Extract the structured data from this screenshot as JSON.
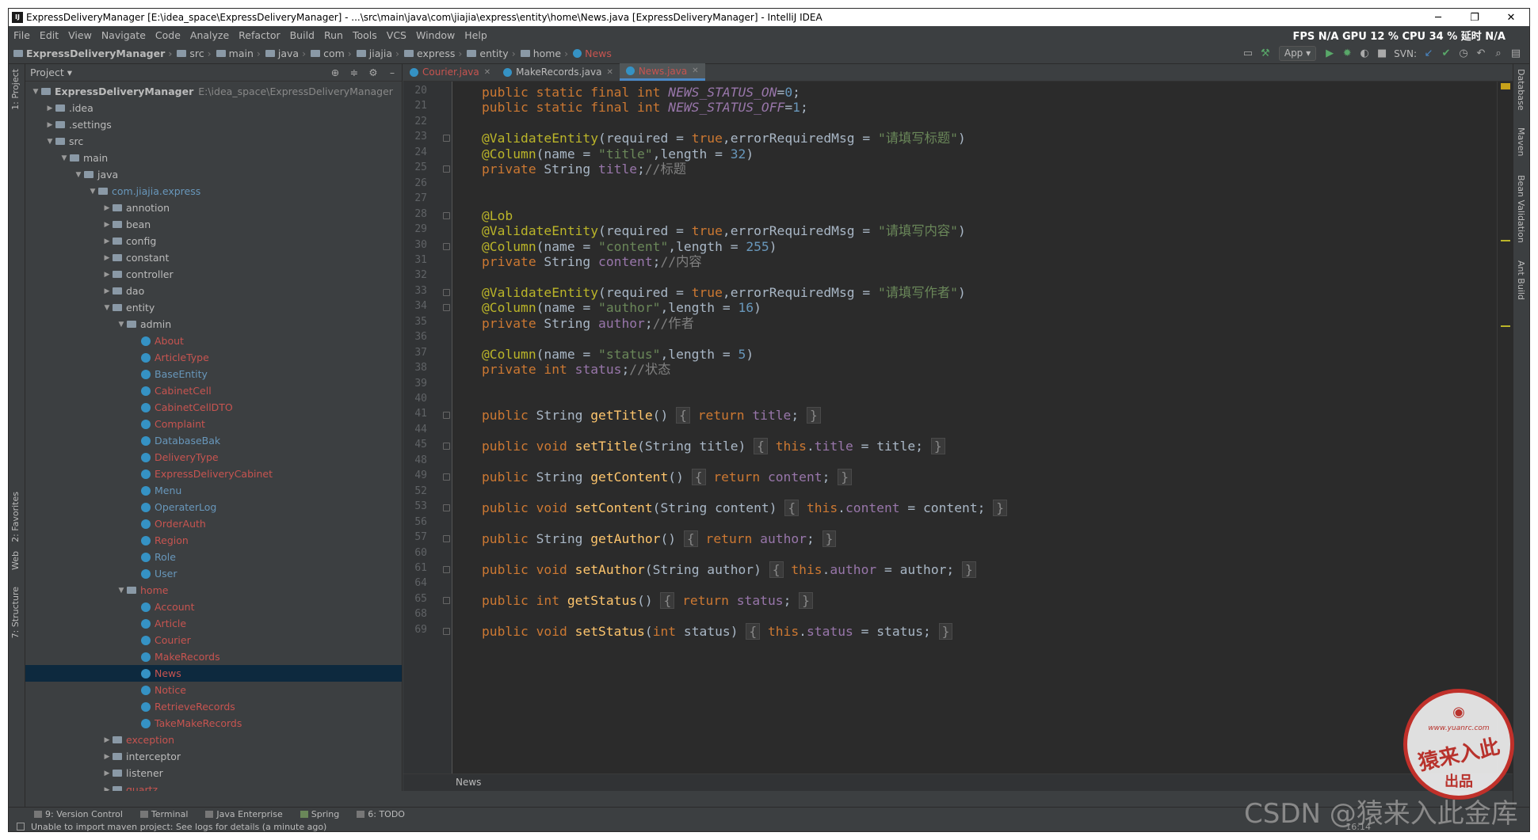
{
  "window": {
    "title": "ExpressDeliveryManager [E:\\idea_space\\ExpressDeliveryManager] - ...\\src\\main\\java\\com\\jiajia\\express\\entity\\home\\News.java [ExpressDeliveryManager] - IntelliJ IDEA",
    "app_icon": "IJ",
    "minimize": "─",
    "maximize": "❐",
    "close": "✕"
  },
  "menu": [
    "File",
    "Edit",
    "View",
    "Navigate",
    "Code",
    "Analyze",
    "Refactor",
    "Build",
    "Run",
    "Tools",
    "VCS",
    "Window",
    "Help"
  ],
  "perf": "FPS  N/A  GPU  12 %  CPU  34 %  延时  N/A",
  "breadcrumbs": [
    "ExpressDeliveryManager",
    "src",
    "main",
    "java",
    "com",
    "jiajia",
    "express",
    "entity",
    "home",
    "News"
  ],
  "toolbar": {
    "run_config": "App ▾",
    "svn_label": "SVN:"
  },
  "project_panel": {
    "title": "Project ▾",
    "root_path": "E:\\idea_space\\ExpressDeliveryManager",
    "tree": [
      {
        "label": "ExpressDeliveryManager",
        "level": 0,
        "arrow": "▼",
        "type": "folder",
        "bold": true
      },
      {
        "label": ".idea",
        "level": 1,
        "arrow": "▶",
        "type": "folder"
      },
      {
        "label": ".settings",
        "level": 1,
        "arrow": "▶",
        "type": "folder"
      },
      {
        "label": "src",
        "level": 1,
        "arrow": "▼",
        "type": "folder"
      },
      {
        "label": "main",
        "level": 2,
        "arrow": "▼",
        "type": "folder"
      },
      {
        "label": "java",
        "level": 3,
        "arrow": "▼",
        "type": "folder"
      },
      {
        "label": "com.jiajia.express",
        "level": 4,
        "arrow": "▼",
        "type": "package",
        "color": "teal"
      },
      {
        "label": "annotion",
        "level": 5,
        "arrow": "▶",
        "type": "package"
      },
      {
        "label": "bean",
        "level": 5,
        "arrow": "▶",
        "type": "package"
      },
      {
        "label": "config",
        "level": 5,
        "arrow": "▶",
        "type": "package"
      },
      {
        "label": "constant",
        "level": 5,
        "arrow": "▶",
        "type": "package"
      },
      {
        "label": "controller",
        "level": 5,
        "arrow": "▶",
        "type": "package"
      },
      {
        "label": "dao",
        "level": 5,
        "arrow": "▶",
        "type": "package"
      },
      {
        "label": "entity",
        "level": 5,
        "arrow": "▼",
        "type": "package"
      },
      {
        "label": "admin",
        "level": 6,
        "arrow": "▼",
        "type": "package"
      },
      {
        "label": "About",
        "level": 7,
        "type": "class",
        "color": "red"
      },
      {
        "label": "ArticleType",
        "level": 7,
        "type": "class",
        "color": "red"
      },
      {
        "label": "BaseEntity",
        "level": 7,
        "type": "class",
        "color": "teal"
      },
      {
        "label": "CabinetCell",
        "level": 7,
        "type": "class",
        "color": "red"
      },
      {
        "label": "CabinetCellDTO",
        "level": 7,
        "type": "class",
        "color": "red"
      },
      {
        "label": "Complaint",
        "level": 7,
        "type": "class",
        "color": "red"
      },
      {
        "label": "DatabaseBak",
        "level": 7,
        "type": "class",
        "color": "teal"
      },
      {
        "label": "DeliveryType",
        "level": 7,
        "type": "class",
        "color": "red"
      },
      {
        "label": "ExpressDeliveryCabinet",
        "level": 7,
        "type": "class",
        "color": "red"
      },
      {
        "label": "Menu",
        "level": 7,
        "type": "class",
        "color": "teal"
      },
      {
        "label": "OperaterLog",
        "level": 7,
        "type": "class",
        "color": "teal"
      },
      {
        "label": "OrderAuth",
        "level": 7,
        "type": "class",
        "color": "red"
      },
      {
        "label": "Region",
        "level": 7,
        "type": "class",
        "color": "red"
      },
      {
        "label": "Role",
        "level": 7,
        "type": "class",
        "color": "teal"
      },
      {
        "label": "User",
        "level": 7,
        "type": "class",
        "color": "teal"
      },
      {
        "label": "home",
        "level": 6,
        "arrow": "▼",
        "type": "package",
        "color": "red"
      },
      {
        "label": "Account",
        "level": 7,
        "type": "class",
        "color": "red"
      },
      {
        "label": "Article",
        "level": 7,
        "type": "class",
        "color": "red"
      },
      {
        "label": "Courier",
        "level": 7,
        "type": "class",
        "color": "red"
      },
      {
        "label": "MakeRecords",
        "level": 7,
        "type": "class",
        "color": "red"
      },
      {
        "label": "News",
        "level": 7,
        "type": "class",
        "color": "red",
        "selected": true
      },
      {
        "label": "Notice",
        "level": 7,
        "type": "class",
        "color": "red"
      },
      {
        "label": "RetrieveRecords",
        "level": 7,
        "type": "class",
        "color": "red"
      },
      {
        "label": "TakeMakeRecords",
        "level": 7,
        "type": "class",
        "color": "red"
      },
      {
        "label": "exception",
        "level": 5,
        "arrow": "▶",
        "type": "package",
        "color": "red"
      },
      {
        "label": "interceptor",
        "level": 5,
        "arrow": "▶",
        "type": "package"
      },
      {
        "label": "listener",
        "level": 5,
        "arrow": "▶",
        "type": "package"
      },
      {
        "label": "quartz",
        "level": 5,
        "arrow": "▶",
        "type": "package",
        "color": "red"
      }
    ]
  },
  "editor_tabs": [
    {
      "label": "Courier.java",
      "active": false
    },
    {
      "label": "MakeRecords.java",
      "active": false
    },
    {
      "label": "News.java",
      "active": true
    }
  ],
  "code_lines": [
    {
      "n": "20",
      "html": "<span class=\"kw\">public static final int </span><span class=\"fds\">NEWS_STATUS_ON</span>=<span class=\"nu\">0</span>;"
    },
    {
      "n": "21",
      "html": "<span class=\"kw\">public static final int </span><span class=\"fds\">NEWS_STATUS_OFF</span>=<span class=\"nu\">1</span>;"
    },
    {
      "n": "22",
      "html": ""
    },
    {
      "n": "23",
      "html": "<span class=\"an\">@ValidateEntity</span>(required = <span class=\"kw\">true</span>,errorRequiredMsg = <span class=\"st\">\"请填写标题\"</span>)",
      "fold": true
    },
    {
      "n": "24",
      "html": "<span class=\"an\">@Column</span>(name = <span class=\"st\">\"title\"</span>,length = <span class=\"nu\">32</span>)"
    },
    {
      "n": "25",
      "html": "<span class=\"kw\">private </span>String <span class=\"fd\">title</span>;<span class=\"cm\">//标题</span>",
      "fold": true
    },
    {
      "n": "26",
      "html": ""
    },
    {
      "n": "27",
      "html": ""
    },
    {
      "n": "28",
      "html": "<span class=\"an\">@Lob</span>",
      "fold": true
    },
    {
      "n": "29",
      "html": "<span class=\"an\">@ValidateEntity</span>(required = <span class=\"kw\">true</span>,errorRequiredMsg = <span class=\"st\">\"请填写内容\"</span>)"
    },
    {
      "n": "30",
      "html": "<span class=\"an\">@Column</span>(name = <span class=\"st\">\"content\"</span>,length = <span class=\"nu\">255</span>)",
      "fold": true
    },
    {
      "n": "31",
      "html": "<span class=\"kw\">private </span>String <span class=\"fd\">content</span>;<span class=\"cm\">//内容</span>"
    },
    {
      "n": "32",
      "html": ""
    },
    {
      "n": "33",
      "html": "<span class=\"an\">@ValidateEntity</span>(required = <span class=\"kw\">true</span>,errorRequiredMsg = <span class=\"st\">\"请填写作者\"</span>)",
      "fold": true
    },
    {
      "n": "34",
      "html": "<span class=\"an\">@Column</span>(name = <span class=\"st\">\"author\"</span>,length = <span class=\"nu\">16</span>)",
      "fold": true
    },
    {
      "n": "35",
      "html": "<span class=\"kw\">private </span>String <span class=\"fd\">author</span>;<span class=\"cm\">//作者</span>"
    },
    {
      "n": "36",
      "html": ""
    },
    {
      "n": "37",
      "html": "<span class=\"an\">@Column</span>(name = <span class=\"st\">\"status\"</span>,length = <span class=\"nu\">5</span>)"
    },
    {
      "n": "38",
      "html": "<span class=\"kw\">private int </span><span class=\"fd\">status</span>;<span class=\"cm\">//状态</span>"
    },
    {
      "n": "39",
      "html": ""
    },
    {
      "n": "40",
      "html": ""
    },
    {
      "n": "41",
      "html": "<span class=\"kw\">public </span>String <span class=\"mt\">getTitle</span>() <span class=\"br\">{</span> <span class=\"kw\">return </span><span class=\"fd\">title</span>; <span class=\"br\">}</span>",
      "fold": true
    },
    {
      "n": "44",
      "html": ""
    },
    {
      "n": "45",
      "html": "<span class=\"kw\">public void </span><span class=\"mt\">setTitle</span>(String title) <span class=\"br\">{</span> <span class=\"kw\">this</span>.<span class=\"fd\">title</span> = title; <span class=\"br\">}</span>",
      "fold": true
    },
    {
      "n": "48",
      "html": ""
    },
    {
      "n": "49",
      "html": "<span class=\"kw\">public </span>String <span class=\"mt\">getContent</span>() <span class=\"br\">{</span> <span class=\"kw\">return </span><span class=\"fd\">content</span>; <span class=\"br\">}</span>",
      "fold": true
    },
    {
      "n": "52",
      "html": ""
    },
    {
      "n": "53",
      "html": "<span class=\"kw\">public void </span><span class=\"mt\">setContent</span>(String content) <span class=\"br\">{</span> <span class=\"kw\">this</span>.<span class=\"fd\">content</span> = content; <span class=\"br\">}</span>",
      "fold": true
    },
    {
      "n": "56",
      "html": ""
    },
    {
      "n": "57",
      "html": "<span class=\"kw\">public </span>String <span class=\"mt\">getAuthor</span>() <span class=\"br\">{</span> <span class=\"kw\">return </span><span class=\"fd\">author</span>; <span class=\"br\">}</span>",
      "fold": true
    },
    {
      "n": "60",
      "html": ""
    },
    {
      "n": "61",
      "html": "<span class=\"kw\">public void </span><span class=\"mt\">setAuthor</span>(String author) <span class=\"br\">{</span> <span class=\"kw\">this</span>.<span class=\"fd\">author</span> = author; <span class=\"br\">}</span>",
      "fold": true
    },
    {
      "n": "64",
      "html": ""
    },
    {
      "n": "65",
      "html": "<span class=\"kw\">public int </span><span class=\"mt\">getStatus</span>() <span class=\"br\">{</span> <span class=\"kw\">return </span><span class=\"fd\">status</span>; <span class=\"br\">}</span>",
      "fold": true
    },
    {
      "n": "68",
      "html": ""
    },
    {
      "n": "69",
      "html": "<span class=\"kw\">public void </span><span class=\"mt\">setStatus</span>(<span class=\"kw\">int </span>status) <span class=\"br\">{</span> <span class=\"kw\">this</span>.<span class=\"fd\">status</span> = status; <span class=\"br\">}</span>",
      "fold": true
    }
  ],
  "editor_breadcrumb": "News",
  "left_tool_tabs": [
    "1: Project",
    "2: Favorites",
    "Web",
    "7: Structure"
  ],
  "right_tool_tabs": [
    "Database",
    "Maven",
    "Bean Validation",
    "Ant Build"
  ],
  "bottom_tool_tabs": [
    "9: Version Control",
    "Terminal",
    "Java Enterprise",
    "Spring",
    "6: TODO"
  ],
  "status_message": "Unable to import maven project: See logs for details (a minute ago)",
  "cursor_pos": "16:14",
  "stamp": {
    "top": "◉",
    "url": "www.yuanrc.com",
    "main": "猿来入此",
    "bottom": "出品"
  },
  "watermark": "CSDN @猿来入此金库",
  "colors": {
    "bg_editor": "#2b2b2b",
    "keyword": "#cc7832",
    "annotation": "#bbb529",
    "string": "#6a8759",
    "number": "#6897bb",
    "field": "#9876aa",
    "method": "#ffc66d",
    "modified_file": "#c75450"
  }
}
